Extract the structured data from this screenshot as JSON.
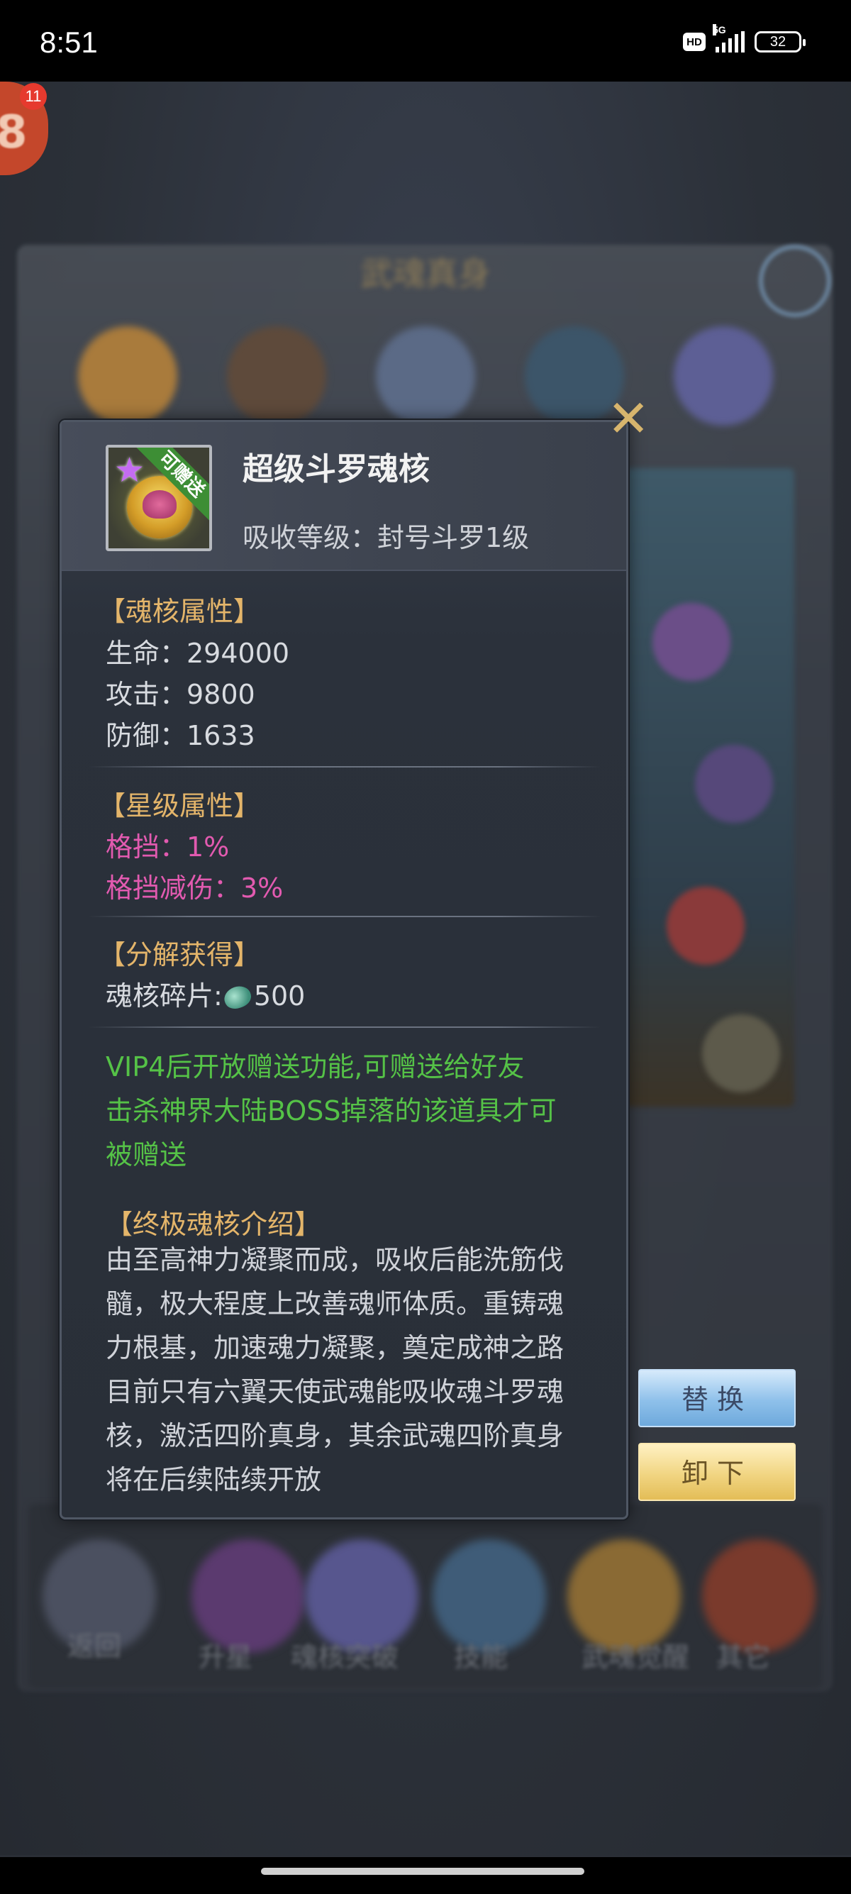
{
  "status_bar": {
    "time": "8:51",
    "hd_label": "HD",
    "network": "5G",
    "battery": "32"
  },
  "avatar": {
    "level": "8",
    "notification_count": "11"
  },
  "background": {
    "panel_title": "武魂真身",
    "bottom_labels": [
      "返回",
      "升星",
      "魂核突破",
      "技能",
      "武魂觉醒",
      "其它"
    ]
  },
  "item": {
    "name": "超级斗罗魂核",
    "absorb_level": "吸收等级：封号斗罗1级",
    "badge": "可赠送"
  },
  "core_attributes": {
    "title": "【魂核属性】",
    "stats": [
      "生命：294000",
      "攻击：9800",
      "防御：1633"
    ]
  },
  "star_attributes": {
    "title": "【星级属性】",
    "stats": [
      "格挡：1%",
      "格挡减伤：3%"
    ]
  },
  "decompose": {
    "title": "【分解获得】",
    "label": "魂核碎片:",
    "amount": "500"
  },
  "gift_note": [
    "VIP4后开放赠送功能,可赠送给好友",
    "击杀神界大陆BOSS掉落的该道具才可",
    "被赠送"
  ],
  "intro": {
    "title": "【终极魂核介绍】",
    "lines": [
      "由至高神力凝聚而成，吸收后能洗筋伐",
      "髓，极大程度上改善魂师体质。重铸魂",
      "力根基，加速魂力凝聚，奠定成神之路",
      "目前只有六翼天使武魂能吸收魂斗罗魂",
      "核，激活四阶真身，其余武魂四阶真身",
      "将在后续陆续开放"
    ]
  },
  "buttons": {
    "replace": "替换",
    "remove": "卸下"
  },
  "icons": {
    "close": "close-icon",
    "shard": "soul-core-shard-icon",
    "item": "soul-core-item-icon"
  },
  "colors": {
    "section_title": "#e4b56a",
    "star_stat": "#e25ab0",
    "gift_note": "#55c247"
  }
}
